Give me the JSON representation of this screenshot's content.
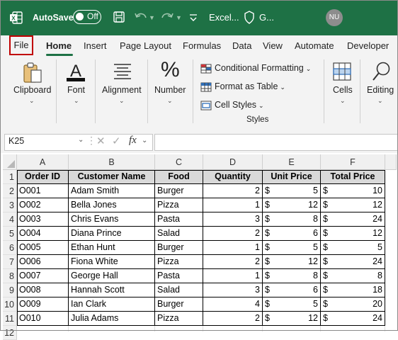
{
  "titlebar": {
    "autosave_label": "AutoSave",
    "toggle_state": "Off",
    "filename": "Excel...",
    "sensitivity": "G...",
    "user_initials": "NU",
    "background": "#1e7145"
  },
  "menu": {
    "items": [
      "File",
      "Home",
      "Insert",
      "Page Layout",
      "Formulas",
      "Data",
      "View",
      "Automate",
      "Developer"
    ],
    "active": "Home",
    "highlighted": "File"
  },
  "ribbon": {
    "clipboard": "Clipboard",
    "font": "Font",
    "alignment": "Alignment",
    "number": "Number",
    "conditional_formatting": "Conditional Formatting",
    "format_as_table": "Format as Table",
    "cell_styles": "Cell Styles",
    "styles_group": "Styles",
    "cells": "Cells",
    "editing": "Editing",
    "number_glyph": "%",
    "font_glyph": "A"
  },
  "formula_bar": {
    "name_box": "K25",
    "fx": "fx",
    "formula": ""
  },
  "sheet": {
    "columns": [
      "A",
      "B",
      "C",
      "D",
      "E",
      "F"
    ],
    "row_numbers": [
      "1",
      "2",
      "3",
      "4",
      "5",
      "6",
      "7",
      "8",
      "9",
      "10",
      "11",
      "12"
    ],
    "headers": [
      "Order ID",
      "Customer Name",
      "Food",
      "Quantity",
      "Unit Price",
      "Total Price"
    ],
    "rows": [
      [
        "O001",
        "Adam Smith",
        "Burger",
        "2",
        "5",
        "10"
      ],
      [
        "O002",
        "Bella Jones",
        "Pizza",
        "1",
        "12",
        "12"
      ],
      [
        "O003",
        "Chris Evans",
        "Pasta",
        "3",
        "8",
        "24"
      ],
      [
        "O004",
        "Diana Prince",
        "Salad",
        "2",
        "6",
        "12"
      ],
      [
        "O005",
        "Ethan Hunt",
        "Burger",
        "1",
        "5",
        "5"
      ],
      [
        "O006",
        "Fiona White",
        "Pizza",
        "2",
        "12",
        "24"
      ],
      [
        "O007",
        "George Hall",
        "Pasta",
        "1",
        "8",
        "8"
      ],
      [
        "O008",
        "Hannah Scott",
        "Salad",
        "3",
        "6",
        "18"
      ],
      [
        "O009",
        "Ian Clark",
        "Burger",
        "4",
        "5",
        "20"
      ],
      [
        "O010",
        "Julia Adams",
        "Pizza",
        "2",
        "12",
        "24"
      ]
    ],
    "currency": "$"
  },
  "icons": [
    "excel-logo-icon",
    "save-icon",
    "undo-icon",
    "redo-icon",
    "customize-icon",
    "shield-icon",
    "clipboard-icon",
    "font-icon",
    "alignment-icon",
    "percent-icon",
    "conditional-formatting-icon",
    "format-table-icon",
    "cell-styles-icon",
    "cells-icon",
    "search-icon",
    "cancel-icon",
    "enter-icon",
    "fx-icon"
  ]
}
